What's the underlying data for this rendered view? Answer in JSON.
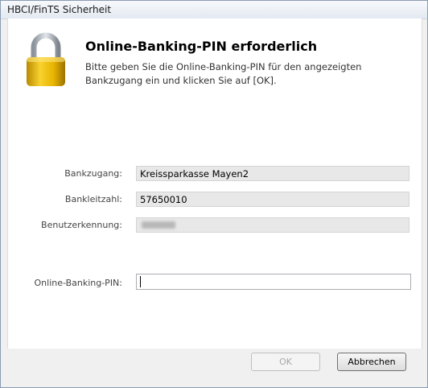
{
  "window": {
    "title": "HBCI/FinTS Sicherheit"
  },
  "header": {
    "title": "Online-Banking-PIN erforderlich",
    "description": "Bitte geben Sie die Online-Banking-PIN für den angezeigten Bankzugang ein und klicken Sie auf [OK]."
  },
  "fields": {
    "bankzugang": {
      "label": "Bankzugang:",
      "value": "Kreissparkasse Mayen2"
    },
    "bankleitzahl": {
      "label": "Bankleitzahl:",
      "value": "57650010"
    },
    "benutzerkennung": {
      "label": "Benutzerkennung:",
      "value": ""
    },
    "pin": {
      "label": "Online-Banking-PIN:",
      "value": ""
    }
  },
  "buttons": {
    "ok": "OK",
    "cancel": "Abbrechen"
  },
  "colors": {
    "lock_gold": "#e8b400",
    "lock_shackle": "#b8bec6"
  },
  "icons": {
    "header": "lock-icon"
  }
}
